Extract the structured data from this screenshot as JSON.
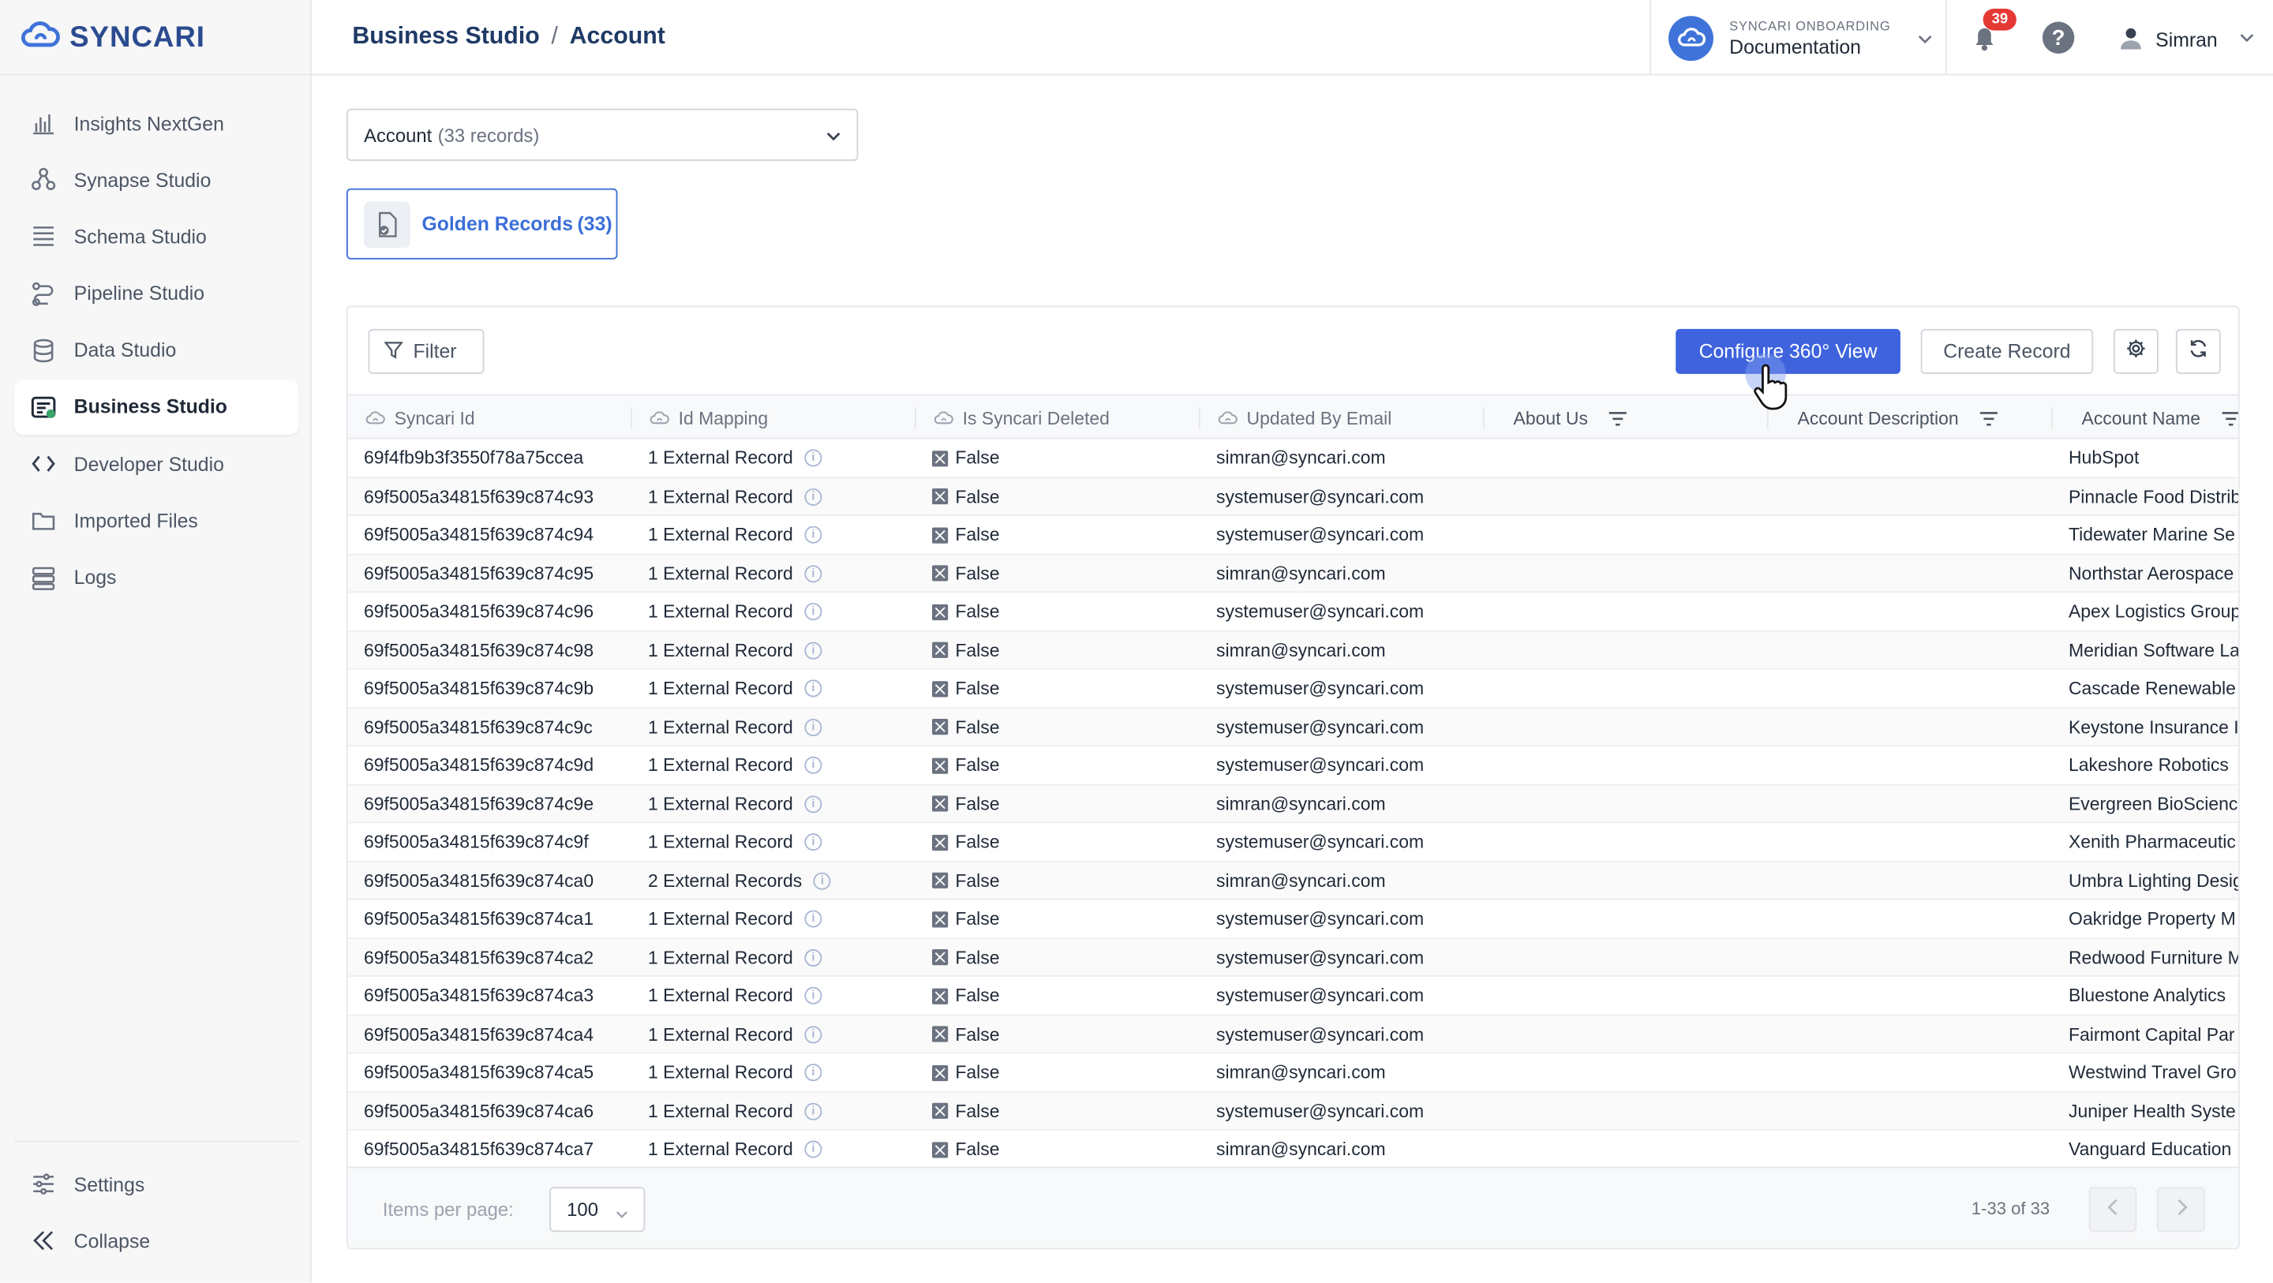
{
  "app": {
    "logo_text": "SYNCARI"
  },
  "sidebar": {
    "items": [
      {
        "label": "Insights NextGen",
        "icon": "bar-chart-icon"
      },
      {
        "label": "Synapse Studio",
        "icon": "synapse-icon"
      },
      {
        "label": "Schema Studio",
        "icon": "schema-icon"
      },
      {
        "label": "Pipeline Studio",
        "icon": "pipeline-icon"
      },
      {
        "label": "Data Studio",
        "icon": "database-icon"
      },
      {
        "label": "Business Studio",
        "icon": "business-icon",
        "active": true
      },
      {
        "label": "Developer Studio",
        "icon": "code-icon"
      },
      {
        "label": "Imported Files",
        "icon": "folder-icon"
      },
      {
        "label": "Logs",
        "icon": "logs-icon"
      }
    ],
    "bottom": [
      {
        "label": "Settings",
        "icon": "sliders-icon"
      },
      {
        "label": "Collapse",
        "icon": "double-chevron-left-icon"
      }
    ]
  },
  "header": {
    "breadcrumb": [
      "Business Studio",
      "Account"
    ],
    "breadcrumb_sep": "/",
    "org_label": "SYNCARI ONBOARDING",
    "org_name": "Documentation",
    "notification_count": "39",
    "help_label": "?",
    "user_name": "Simran"
  },
  "entity_select": {
    "value": "Account",
    "count_text": "(33 records)"
  },
  "golden_records": {
    "label": "Golden Records",
    "count": "(33)"
  },
  "toolbar": {
    "filter_label": "Filter",
    "configure_label": "Configure 360° View",
    "create_label": "Create Record"
  },
  "table": {
    "columns": [
      {
        "label": "Syncari Id",
        "system": true
      },
      {
        "label": "Id Mapping",
        "system": true
      },
      {
        "label": "Is Syncari Deleted",
        "system": true
      },
      {
        "label": "Updated By Email",
        "system": true
      },
      {
        "label": "About Us",
        "filter": true
      },
      {
        "label": "Account Description",
        "filter": true
      },
      {
        "label": "Account Name",
        "filter": true
      }
    ],
    "rows": [
      [
        "69f4fb9b3f3550f78a75ccea",
        "1 External Record",
        "False",
        "simran@syncari.com",
        "",
        "",
        "HubSpot"
      ],
      [
        "69f5005a34815f639c874c93",
        "1 External Record",
        "False",
        "systemuser@syncari.com",
        "",
        "",
        "Pinnacle Food Distrib"
      ],
      [
        "69f5005a34815f639c874c94",
        "1 External Record",
        "False",
        "systemuser@syncari.com",
        "",
        "",
        "Tidewater Marine Se"
      ],
      [
        "69f5005a34815f639c874c95",
        "1 External Record",
        "False",
        "simran@syncari.com",
        "",
        "",
        "Northstar Aerospace"
      ],
      [
        "69f5005a34815f639c874c96",
        "1 External Record",
        "False",
        "systemuser@syncari.com",
        "",
        "",
        "Apex Logistics Group"
      ],
      [
        "69f5005a34815f639c874c98",
        "1 External Record",
        "False",
        "simran@syncari.com",
        "",
        "",
        "Meridian Software La"
      ],
      [
        "69f5005a34815f639c874c9b",
        "1 External Record",
        "False",
        "systemuser@syncari.com",
        "",
        "",
        "Cascade Renewable E"
      ],
      [
        "69f5005a34815f639c874c9c",
        "1 External Record",
        "False",
        "systemuser@syncari.com",
        "",
        "",
        "Keystone Insurance I"
      ],
      [
        "69f5005a34815f639c874c9d",
        "1 External Record",
        "False",
        "systemuser@syncari.com",
        "",
        "",
        "Lakeshore Robotics"
      ],
      [
        "69f5005a34815f639c874c9e",
        "1 External Record",
        "False",
        "simran@syncari.com",
        "",
        "",
        "Evergreen BioScienc"
      ],
      [
        "69f5005a34815f639c874c9f",
        "1 External Record",
        "False",
        "systemuser@syncari.com",
        "",
        "",
        "Xenith Pharmaceutic"
      ],
      [
        "69f5005a34815f639c874ca0",
        "2 External Records",
        "False",
        "simran@syncari.com",
        "",
        "",
        "Umbra Lighting Desig"
      ],
      [
        "69f5005a34815f639c874ca1",
        "1 External Record",
        "False",
        "systemuser@syncari.com",
        "",
        "",
        "Oakridge Property M"
      ],
      [
        "69f5005a34815f639c874ca2",
        "1 External Record",
        "False",
        "systemuser@syncari.com",
        "",
        "",
        "Redwood Furniture M"
      ],
      [
        "69f5005a34815f639c874ca3",
        "1 External Record",
        "False",
        "systemuser@syncari.com",
        "",
        "",
        "Bluestone Analytics"
      ],
      [
        "69f5005a34815f639c874ca4",
        "1 External Record",
        "False",
        "systemuser@syncari.com",
        "",
        "",
        "Fairmont Capital Par"
      ],
      [
        "69f5005a34815f639c874ca5",
        "1 External Record",
        "False",
        "simran@syncari.com",
        "",
        "",
        "Westwind Travel Gro"
      ],
      [
        "69f5005a34815f639c874ca6",
        "1 External Record",
        "False",
        "systemuser@syncari.com",
        "",
        "",
        "Juniper Health Syste"
      ],
      [
        "69f5005a34815f639c874ca7",
        "1 External Record",
        "False",
        "simran@syncari.com",
        "",
        "",
        "Vanguard Education"
      ]
    ]
  },
  "pagination": {
    "items_per_page_label": "Items per page:",
    "items_per_page": "100",
    "range": "1-33 of 33"
  },
  "colors": {
    "accent": "#3e63dd",
    "brand": "#2b4b8f",
    "badge": "#e53935"
  }
}
